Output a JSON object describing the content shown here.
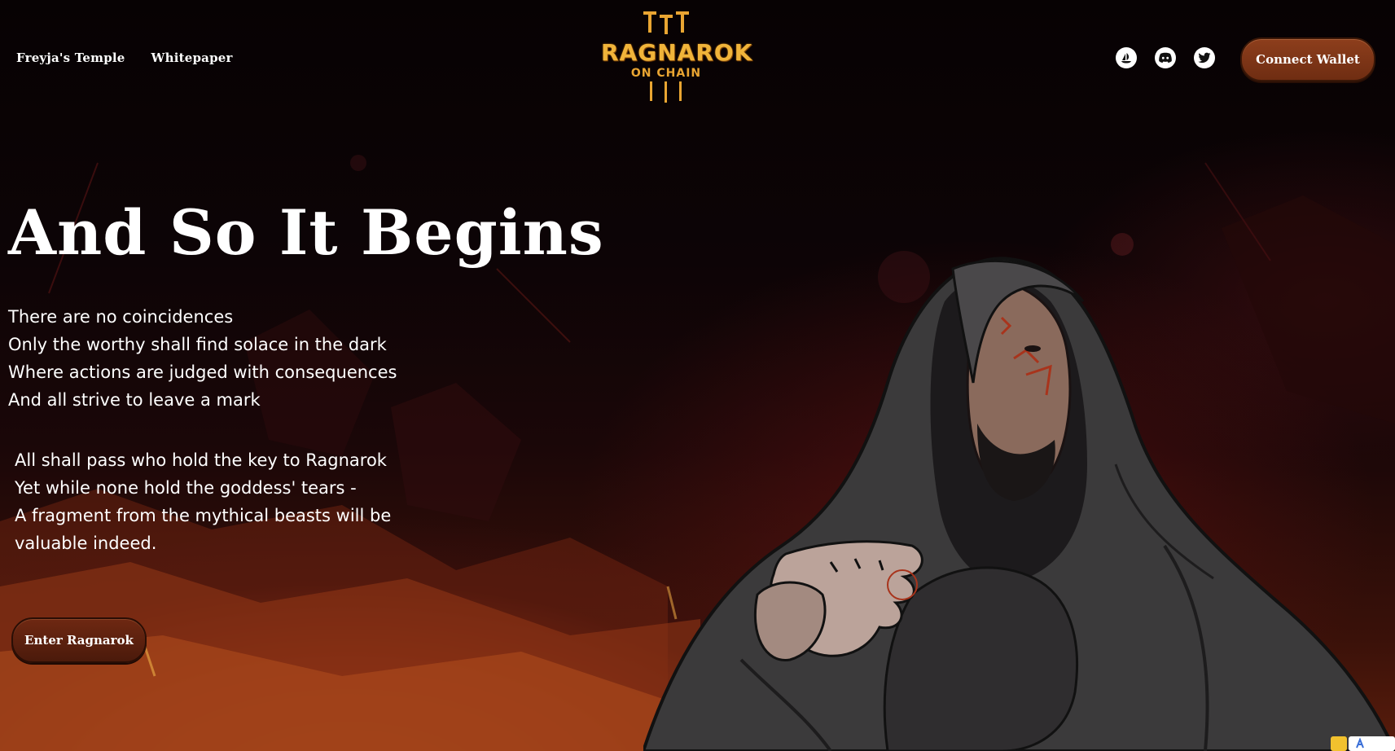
{
  "header": {
    "nav": [
      {
        "label": "Freyja's Temple"
      },
      {
        "label": "Whitepaper"
      }
    ],
    "logo": {
      "title": "RAGNAROK",
      "subtitle": "ON CHAIN"
    },
    "social": [
      {
        "icon": "opensea-icon"
      },
      {
        "icon": "discord-icon"
      },
      {
        "icon": "twitter-icon"
      }
    ],
    "connect_label": "Connect Wallet"
  },
  "hero": {
    "title": "And So It Begins",
    "poem_1": [
      "There are no coincidences",
      "Only the worthy shall find solace in the dark",
      "Where actions are judged with consequences",
      "And all strive to leave a mark"
    ],
    "poem_2": [
      "All shall pass who hold the key to Ragnarok",
      "Yet while none hold the goddess' tears -",
      "A fragment from the mythical beasts will be",
      "valuable indeed."
    ],
    "cta_label": "Enter Ragnarok"
  },
  "colors": {
    "accent_gold": "#f0b43a",
    "button_brown": "#7a3416",
    "background": "#0a0406"
  }
}
